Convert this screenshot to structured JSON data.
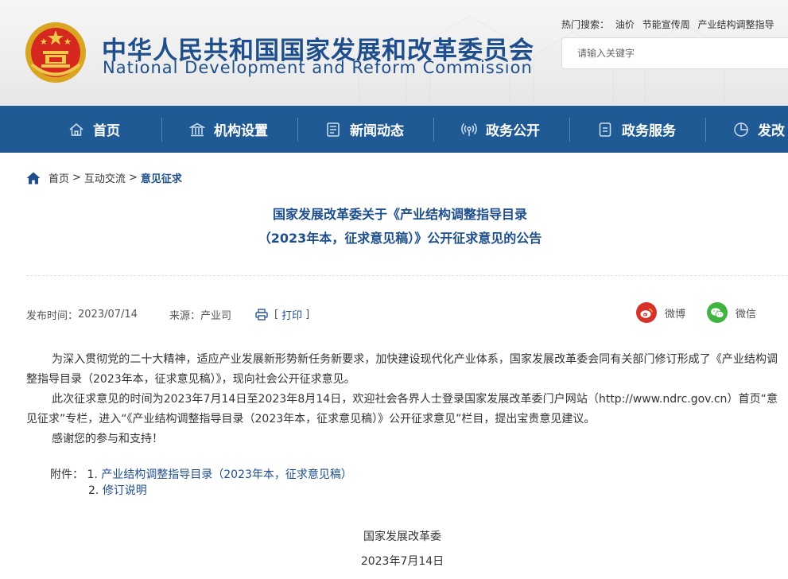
{
  "header": {
    "title_cn": "中华人民共和国国家发展和改革委员会",
    "title_en": "National Development and Reform Commission",
    "hot_label": "热门搜索：",
    "hot_terms": [
      "油价",
      "节能宣传周",
      "产业结构调整指导"
    ],
    "search_placeholder": "请输入关键字",
    "emblem_icon": "national-emblem-icon"
  },
  "nav": {
    "items": [
      {
        "label": "首页",
        "icon": "home-icon"
      },
      {
        "label": "机构设置",
        "icon": "building-icon"
      },
      {
        "label": "新闻动态",
        "icon": "news-icon"
      },
      {
        "label": "政务公开",
        "icon": "broadcast-icon"
      },
      {
        "label": "政务服务",
        "icon": "service-icon"
      },
      {
        "label": "发改",
        "icon": "chart-icon"
      }
    ]
  },
  "breadcrumb": {
    "home": "首页",
    "sep1": ">",
    "level2": "互动交流",
    "sep2": ">",
    "current": "意见征求"
  },
  "article": {
    "title_line1": "国家发展改革委关于《产业结构调整指导目录",
    "title_line2": "（2023年本，征求意见稿）》公开征求意见的公告",
    "publish_label": "发布时间：",
    "publish_date": "2023/07/14",
    "source_label": "来源：",
    "source": "产业司",
    "print_open": "[",
    "print_label": "打印",
    "print_close": "]",
    "share_weibo": "微博",
    "share_wechat": "微信",
    "para1": "为深入贯彻党的二十大精神，适应产业发展新形势新任务新要求，加快建设现代化产业体系，国家发展改革委会同有关部门修订形成了《产业结构调整指导目录（2023年本，征求意见稿）》，现向社会公开征求意见。",
    "para2": "此次征求意见的时间为2023年7月14日至2023年8月14日，欢迎社会各界人士登录国家发展改革委门户网站（http://www.ndrc.gov.cn）首页“意见征求”专栏，进入“《产业结构调整指导目录（2023年本，征求意见稿）》公开征求意见”栏目，提出宝贵意见建议。",
    "para3": "感谢您的参与和支持！",
    "attach_label": "附件：",
    "attach1_num": "1.",
    "attach1_text": "产业结构调整指导目录（2023年本，征求意见稿）",
    "attach2_num": "2.",
    "attach2_text": "修订说明",
    "sign_org": "国家发展改革委",
    "sign_date": "2023年7月14日"
  },
  "colors": {
    "brand_blue": "#1f5a95",
    "title_blue": "#1e4f8c",
    "weibo_red": "#d6322a",
    "wechat_green": "#3fb53f"
  }
}
